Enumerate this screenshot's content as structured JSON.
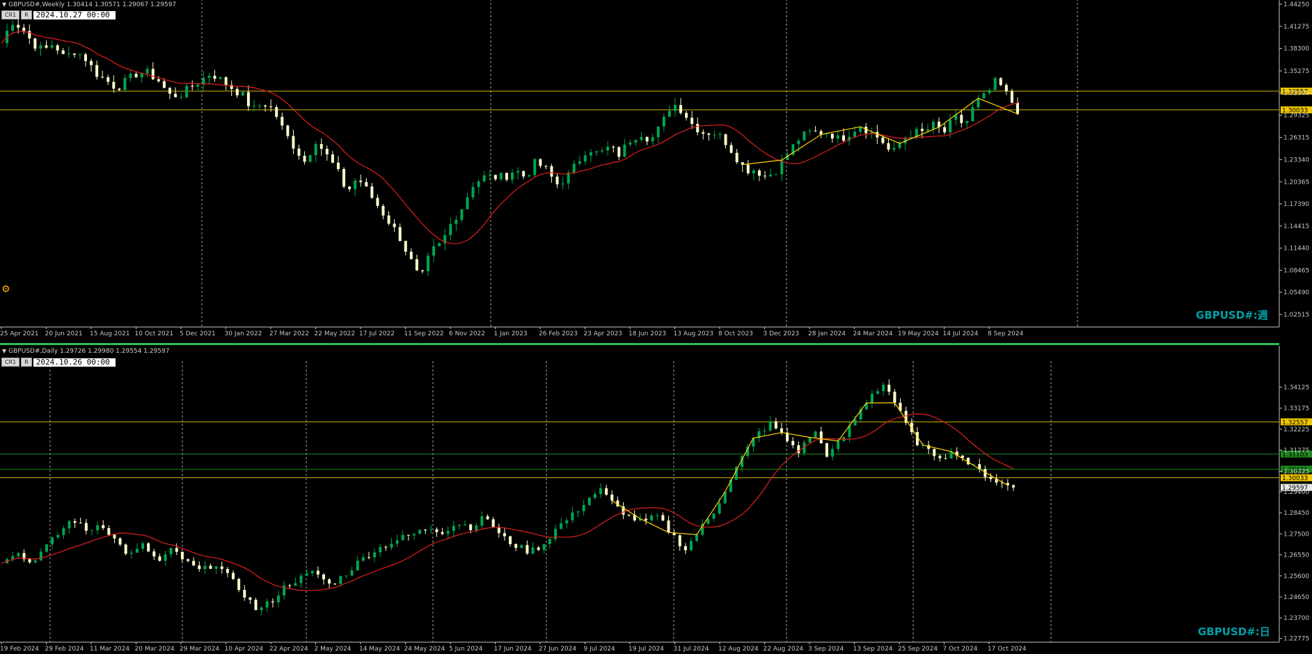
{
  "colors": {
    "background": "#000000",
    "bull_candle": "#00a650",
    "bear_candle": "#ffffcc",
    "moving_average": "#e02020",
    "zigzag": "#ffd400",
    "level_line": "#d4b400",
    "green_line": "#1e8a1e",
    "grid": "#cfcfcf",
    "axis": "#c8c8c8",
    "watermark": "#00a0a8"
  },
  "weekly": {
    "header": "GBPUSD#,Weekly  1.30414 1.30571 1.29067 1.29597",
    "btn1": "CR1",
    "btn2": "R",
    "datetime": "2024.10.27 00:00",
    "watermark": "GBPUSD#:週"
  },
  "daily": {
    "header": "GBPUSD#,Daily  1.29726 1.29980 1.29554 1.29597",
    "btn1": "CR1",
    "btn2": "R",
    "datetime": "2024.10.26 00:00",
    "watermark": "GBPUSD#:日"
  },
  "chart_data": [
    {
      "type": "candlestick",
      "symbol": "GBPUSD#",
      "timeframe": "Weekly",
      "ylim": [
        1.0102,
        1.4425
      ],
      "y_ticks": [
        "1.44250",
        "1.41275",
        "1.38300",
        "1.35275",
        "1.32300",
        "1.29325",
        "1.26315",
        "1.23340",
        "1.20365",
        "1.17390",
        "1.14415",
        "1.11440",
        "1.08465",
        "1.05490",
        "1.02515"
      ],
      "x_labels": [
        "25 Apr 2021",
        "20 Jun 2021",
        "15 Aug 2021",
        "10 Oct 2021",
        "5 Dec 2021",
        "30 Jan 2022",
        "27 Mar 2022",
        "22 May 2022",
        "17 Jul 2022",
        "11 Sep 2022",
        "6 Nov 2022",
        "1 Jan 2023",
        "26 Feb 2023",
        "23 Apr 2023",
        "18 Jun 2023",
        "13 Aug 2023",
        "8 Oct 2023",
        "3 Dec 2023",
        "28 Jan 2024",
        "24 Mar 2024",
        "19 May 2024",
        "14 Jul 2024",
        "8 Sep 2024"
      ],
      "horizontal_levels": [
        {
          "price": 1.32557,
          "label": "1.32557"
        },
        {
          "price": 1.30033,
          "label": "1.30033"
        }
      ],
      "last_ohlc": {
        "open": 1.30414,
        "high": 1.30571,
        "low": 1.29067,
        "close": 1.29597
      },
      "close_path": [
        1.39,
        1.42,
        1.41,
        1.39,
        1.38,
        1.39,
        1.37,
        1.38,
        1.37,
        1.35,
        1.34,
        1.33,
        1.34,
        1.35,
        1.35,
        1.34,
        1.32,
        1.32,
        1.33,
        1.34,
        1.35,
        1.34,
        1.33,
        1.32,
        1.3,
        1.31,
        1.3,
        1.27,
        1.25,
        1.23,
        1.26,
        1.24,
        1.22,
        1.19,
        1.21,
        1.19,
        1.17,
        1.15,
        1.13,
        1.1,
        1.07,
        1.11,
        1.12,
        1.15,
        1.17,
        1.2,
        1.21,
        1.21,
        1.21,
        1.22,
        1.21,
        1.23,
        1.22,
        1.2,
        1.21,
        1.23,
        1.25,
        1.24,
        1.25,
        1.24,
        1.26,
        1.27,
        1.26,
        1.28,
        1.31,
        1.3,
        1.28,
        1.27,
        1.27,
        1.26,
        1.24,
        1.22,
        1.22,
        1.21,
        1.22,
        1.24,
        1.26,
        1.27,
        1.27,
        1.27,
        1.26,
        1.27,
        1.28,
        1.27,
        1.26,
        1.24,
        1.26,
        1.27,
        1.27,
        1.28,
        1.27,
        1.29,
        1.28,
        1.31,
        1.32,
        1.34,
        1.32,
        1.3
      ]
    },
    {
      "type": "candlestick",
      "symbol": "GBPUSD#",
      "timeframe": "Daily",
      "ylim": [
        1.2267,
        1.3505
      ],
      "y_ticks": [
        "1.34125",
        "1.33175",
        "1.32225",
        "1.31275",
        "1.30325",
        "1.29400",
        "1.28450",
        "1.27500",
        "1.26550",
        "1.25600",
        "1.24650",
        "1.23700",
        "1.22775"
      ],
      "x_labels": [
        "19 Feb 2024",
        "29 Feb 2024",
        "11 Mar 2024",
        "20 Mar 2024",
        "29 Mar 2024",
        "10 Apr 2024",
        "22 Apr 2024",
        "2 May 2024",
        "14 May 2024",
        "24 May 2024",
        "5 Jun 2024",
        "17 Jun 2024",
        "27 Jun 2024",
        "9 Jul 2024",
        "19 Jul 2024",
        "31 Jul 2024",
        "12 Aug 2024",
        "22 Aug 2024",
        "3 Sep 2024",
        "13 Sep 2024",
        "25 Sep 2024",
        "7 Oct 2024",
        "17 Oct 2024"
      ],
      "horizontal_levels": [
        {
          "price": 1.32557,
          "label": "1.32557"
        },
        {
          "price": 1.31103,
          "label": "1.31103"
        },
        {
          "price": 1.30421,
          "label": "1.30421"
        },
        {
          "price": 1.30033,
          "label": "1.30033"
        }
      ],
      "current_price": {
        "label": "1.29597",
        "price": 1.29597
      },
      "last_ohlc": {
        "open": 1.29726,
        "high": 1.2998,
        "low": 1.29554,
        "close": 1.29597
      },
      "close_path": [
        1.263,
        1.267,
        1.262,
        1.268,
        1.275,
        1.282,
        1.276,
        1.28,
        1.272,
        1.265,
        1.27,
        1.262,
        1.268,
        1.262,
        1.258,
        1.262,
        1.255,
        1.248,
        1.24,
        1.245,
        1.252,
        1.255,
        1.258,
        1.252,
        1.256,
        1.262,
        1.267,
        1.27,
        1.273,
        1.275,
        1.278,
        1.276,
        1.28,
        1.278,
        1.283,
        1.274,
        1.27,
        1.267,
        1.27,
        1.278,
        1.283,
        1.29,
        1.295,
        1.288,
        1.283,
        1.28,
        1.283,
        1.275,
        1.268,
        1.277,
        1.285,
        1.298,
        1.31,
        1.32,
        1.325,
        1.318,
        1.312,
        1.322,
        1.31,
        1.318,
        1.328,
        1.338,
        1.343,
        1.33,
        1.318,
        1.312,
        1.31,
        1.312,
        1.306,
        1.302,
        1.298,
        1.296
      ]
    }
  ]
}
